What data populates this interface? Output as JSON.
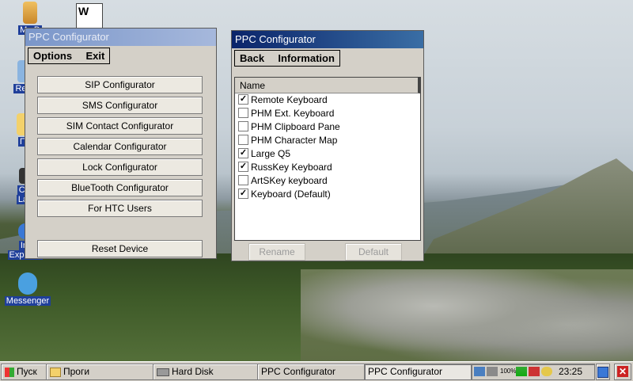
{
  "desktop": {
    "icons": [
      {
        "label": "My D"
      },
      {
        "label": "Recy"
      },
      {
        "label": "Пр"
      },
      {
        "label": "CO"
      },
      {
        "label": "Lau"
      },
      {
        "label": "Int"
      },
      {
        "label": "Explorer"
      },
      {
        "label": "Messenger"
      }
    ]
  },
  "left_window": {
    "title": "PPC Configurator",
    "menu": {
      "options": "Options",
      "exit": "Exit"
    },
    "buttons": [
      "SIP Configurator",
      "SMS Configurator",
      "SIM Contact Configurator",
      "Calendar Configurator",
      "Lock Configurator",
      "BlueTooth Configurator",
      "For HTC Users"
    ],
    "reset": "Reset Device"
  },
  "right_window": {
    "title": "PPC Configurator",
    "menu": {
      "back": "Back",
      "information": "Information"
    },
    "list_header": "Name",
    "items": [
      {
        "label": "Remote Keyboard",
        "checked": true
      },
      {
        "label": "PHM Ext. Keyboard",
        "checked": false
      },
      {
        "label": "PHM Clipboard Pane",
        "checked": false
      },
      {
        "label": "PHM Character Map",
        "checked": false
      },
      {
        "label": "Large Q5",
        "checked": true
      },
      {
        "label": "RussKey Keyboard",
        "checked": true
      },
      {
        "label": "ArtSKey keyboard",
        "checked": false
      },
      {
        "label": "Keyboard  (Default)",
        "checked": true
      }
    ],
    "rename": "Rename",
    "default": "Default"
  },
  "taskbar": {
    "start": "Пуск",
    "items": [
      "Проги",
      "Hard Disk",
      "PPC Configurator",
      "PPC Configurator"
    ],
    "battery": "100%",
    "clock": "23:25"
  },
  "colors": {
    "title_active": "#0a246a",
    "desktop_label_bg": "#1f3f9a"
  }
}
